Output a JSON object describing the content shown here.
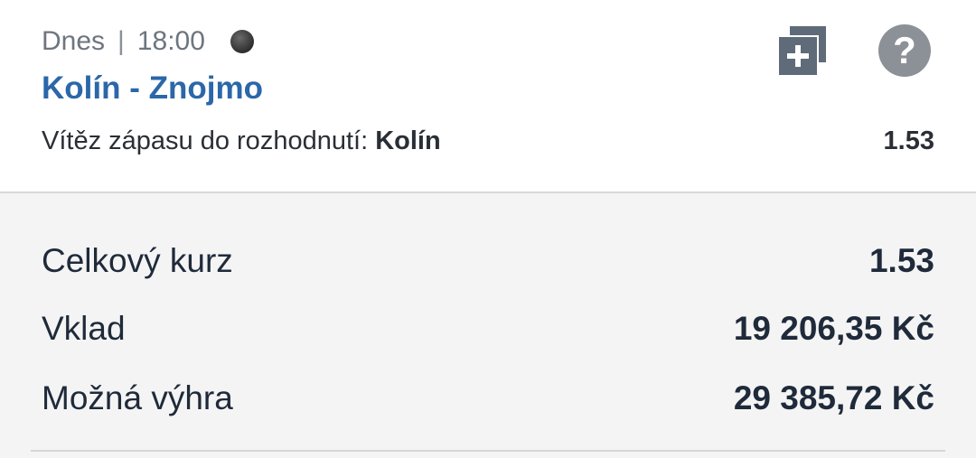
{
  "match": {
    "day": "Dnes",
    "separator": "|",
    "time": "18:00",
    "teams": "Kolín - Znojmo",
    "market_label": "Vítěz zápasu do rozhodnutí:",
    "selection": "Kolín",
    "odd": "1.53"
  },
  "icons": {
    "copy": "add-to-ticket-icon",
    "help": "help-icon",
    "help_glyph": "?",
    "live": "live-indicator-icon"
  },
  "summary": {
    "total_odds_label": "Celkový kurz",
    "total_odds_value": "1.53",
    "stake_label": "Vklad",
    "stake_value": "19 206,35 Kč",
    "win_label": "Možná výhra",
    "win_value": "29 385,72 Kč"
  },
  "colors": {
    "team_link": "#2b67a9",
    "icon_gray": "#8c9198",
    "panel_bg": "#f4f4f4"
  }
}
